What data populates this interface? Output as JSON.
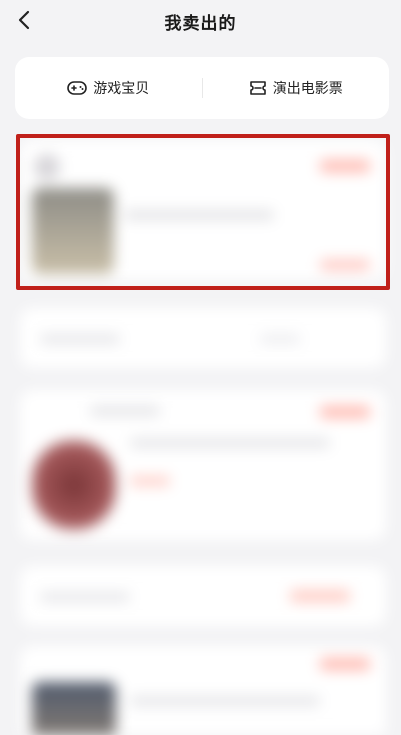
{
  "header": {
    "title": "我卖出的",
    "back_icon": "chevron-left-icon"
  },
  "filters": [
    {
      "label": "游戏宝贝",
      "icon": "gamepad-icon"
    },
    {
      "label": "演出电影票",
      "icon": "ticket-icon"
    }
  ],
  "colors": {
    "background": "#f3f3f5",
    "card": "#ffffff",
    "highlight": "#c0201a",
    "accent": "#ff5a4e"
  }
}
